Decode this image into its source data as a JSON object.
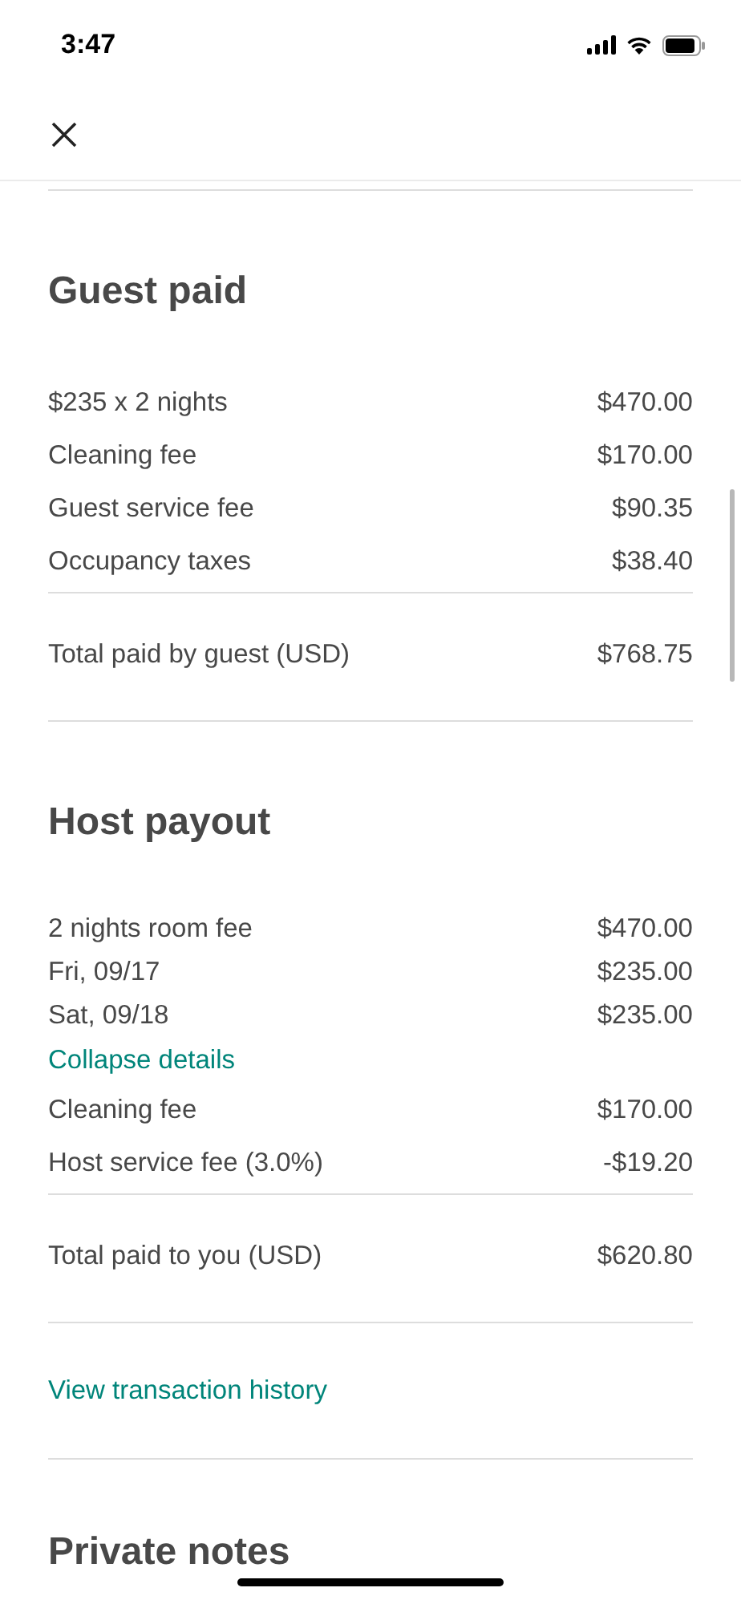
{
  "status_bar": {
    "time": "3:47"
  },
  "sections": [
    {
      "kind": "breakdown",
      "title": "Guest paid",
      "rows": [
        {
          "kind": "item",
          "label": "$235 x 2 nights",
          "amount": "$470.00"
        },
        {
          "kind": "item",
          "label": "Cleaning fee",
          "amount": "$170.00"
        },
        {
          "kind": "item",
          "label": "Guest service fee",
          "amount": "$90.35"
        },
        {
          "kind": "item",
          "label": "Occupancy taxes",
          "amount": "$38.40"
        }
      ],
      "total": {
        "label": "Total paid by guest (USD)",
        "amount": "$768.75"
      }
    },
    {
      "kind": "breakdown",
      "title": "Host payout",
      "rows": [
        {
          "kind": "sub",
          "label": "2 nights room fee",
          "amount": "$470.00"
        },
        {
          "kind": "sub",
          "label": "Fri, 09/17",
          "amount": "$235.00"
        },
        {
          "kind": "sub",
          "label": "Sat, 09/18",
          "amount": "$235.00"
        },
        {
          "kind": "link",
          "label": "Collapse details"
        },
        {
          "kind": "item",
          "label": "Cleaning fee",
          "amount": "$170.00"
        },
        {
          "kind": "item",
          "label": "Host service fee (3.0%)",
          "amount": "-$19.20"
        }
      ],
      "total": {
        "label": "Total paid to you (USD)",
        "amount": "$620.80"
      }
    },
    {
      "kind": "link",
      "label": "View transaction history"
    },
    {
      "kind": "heading",
      "title": "Private notes"
    }
  ]
}
